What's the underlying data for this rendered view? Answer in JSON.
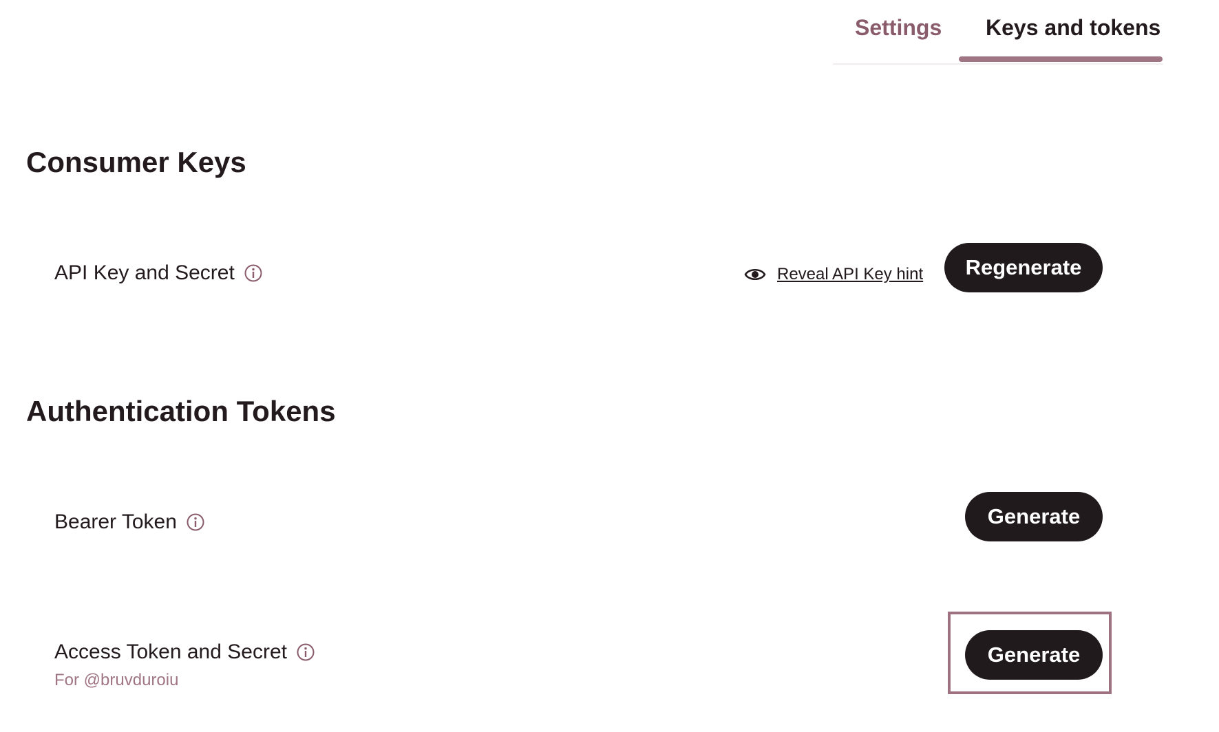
{
  "tabs": {
    "settings": "Settings",
    "keys_and_tokens": "Keys and tokens",
    "active": "Keys and tokens"
  },
  "consumer_keys": {
    "title": "Consumer Keys",
    "api_key": {
      "label": "API Key and Secret",
      "reveal_label": "Reveal API Key hint",
      "button_label": "Regenerate"
    }
  },
  "auth_tokens": {
    "title": "Authentication Tokens",
    "bearer": {
      "label": "Bearer Token",
      "button_label": "Generate"
    },
    "access": {
      "label": "Access Token and Secret",
      "sublabel": "For @bruvduroiu",
      "button_label": "Generate"
    }
  },
  "icons": {
    "info": "info-icon",
    "eye": "eye-icon"
  },
  "colors": {
    "accent": "#a07584",
    "button_bg": "#211a1c",
    "text": "#231a1d",
    "highlight": "#9e7280"
  }
}
